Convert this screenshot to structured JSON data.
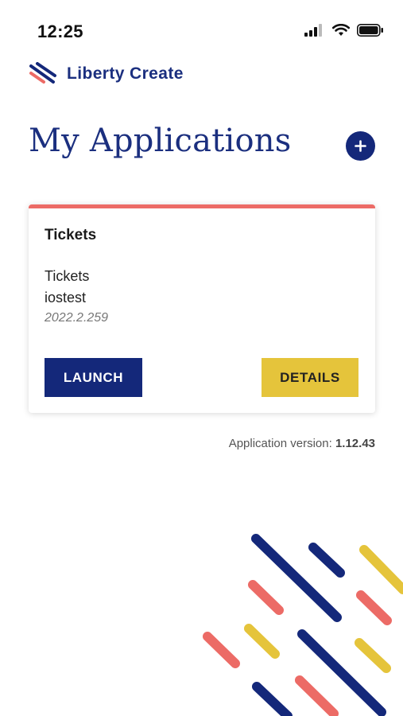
{
  "status_bar": {
    "time": "12:25",
    "icons": [
      "signal-icon",
      "wifi-icon",
      "battery-icon"
    ]
  },
  "brand": {
    "name": "Liberty Create",
    "logo_icon": "liberty-logo-icon"
  },
  "page": {
    "title": "My Applications",
    "add_icon": "plus-icon"
  },
  "application": {
    "title": "Tickets",
    "name": "Tickets",
    "user": "iostest",
    "version": "2022.2.259",
    "launch_label": "LAUNCH",
    "details_label": "DETAILS"
  },
  "footer": {
    "version_label": "Application version:",
    "version_value": "1.12.43"
  },
  "colors": {
    "navy": "#14287a",
    "brand_blue": "#1b2f7f",
    "coral": "#ec6b66",
    "yellow": "#e5c43b"
  }
}
